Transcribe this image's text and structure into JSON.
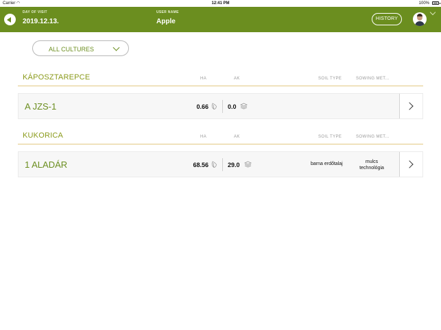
{
  "status_bar": {
    "carrier": "Carrier",
    "time": "12:41 PM",
    "battery": "100%"
  },
  "header": {
    "visit_label": "DAY OF VISIT",
    "visit_date": "2019.12.13.",
    "user_label": "USER NAME",
    "user_name": "Apple",
    "history_label": "HISTORY"
  },
  "filter": {
    "selected": "ALL CULTURES"
  },
  "columns": {
    "ha": "HA",
    "ak": "AK",
    "soil": "SOIL TYPE",
    "sowing": "SOWING MET..."
  },
  "sections": [
    {
      "title": "KÁPOSZTAREPCE",
      "rows": [
        {
          "name": "A JZS-1",
          "ha": "0.66",
          "ak": "0.0",
          "soil": "",
          "sowing": ""
        }
      ]
    },
    {
      "title": "KUKORICA",
      "rows": [
        {
          "name": "1 ALADÁR",
          "ha": "68.56",
          "ak": "29.0",
          "soil": "barna erdőtalaj",
          "sowing": "mulcs technológia"
        }
      ]
    }
  ],
  "colors": {
    "header_bg": "#6b8e1f",
    "section_title": "#8a9a1a",
    "section_rule": "#e3c882"
  }
}
